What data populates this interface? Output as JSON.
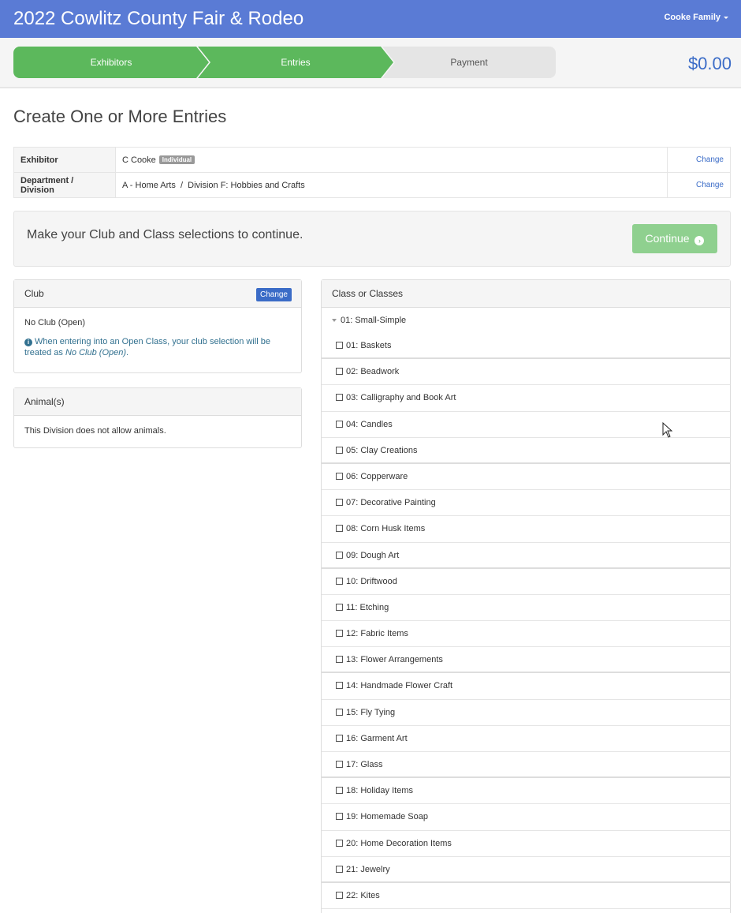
{
  "header": {
    "title": "2022 Cowlitz County Fair & Rodeo",
    "user": "Cooke Family"
  },
  "steps": {
    "exhibitors": "Exhibitors",
    "entries": "Entries",
    "payment": "Payment",
    "total": "$0.00"
  },
  "page": {
    "heading": "Create One or More Entries"
  },
  "info": {
    "exhibitor_label": "Exhibitor",
    "exhibitor_value": "C Cooke",
    "exhibitor_badge": "Individual",
    "exhibitor_change": "Change",
    "dept_label": "Department / Division",
    "dept_value": "A - Home Arts  /  Division F: Hobbies and Crafts",
    "dept_change": "Change"
  },
  "notice": {
    "message": "Make your Club and Class selections to continue.",
    "continue": "Continue"
  },
  "club": {
    "title": "Club",
    "change": "Change",
    "value": "No Club (Open)",
    "note_prefix": "When entering into an Open Class, your club selection will be treated as ",
    "note_em": "No Club (Open)",
    "note_suffix": "."
  },
  "animals": {
    "title": "Animal(s)",
    "message": "This Division does not allow animals."
  },
  "classes": {
    "title": "Class or Classes",
    "group": "01: Small-Simple",
    "items": [
      "01: Baskets",
      "02: Beadwork",
      "03: Calligraphy and Book Art",
      "04: Candles",
      "05: Clay Creations",
      "06: Copperware",
      "07: Decorative Painting",
      "08: Corn Husk Items",
      "09: Dough Art",
      "10: Driftwood",
      "11: Etching",
      "12: Fabric Items",
      "13: Flower Arrangements",
      "14: Handmade Flower Craft",
      "15: Fly Tying",
      "16: Garment Art",
      "17: Glass",
      "18: Holiday Items",
      "19: Homemade Soap",
      "20: Home Decoration Items",
      "21: Jewelry",
      "22: Kites"
    ]
  }
}
